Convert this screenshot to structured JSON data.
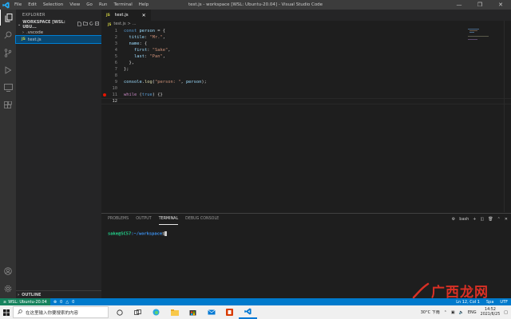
{
  "window": {
    "title": "test.js - workspace [WSL: Ubuntu-20.04] - Visual Studio Code",
    "menu": [
      "File",
      "Edit",
      "Selection",
      "View",
      "Go",
      "Run",
      "Terminal",
      "Help"
    ]
  },
  "sidebar": {
    "header": "EXPLORER",
    "workspace_label": "WORKSPACE [WSL: UBU...",
    "items": [
      {
        "label": ".vscode",
        "type": "folder"
      },
      {
        "label": "test.js",
        "type": "js-file",
        "badge": "JS"
      }
    ],
    "outline_label": "OUTLINE"
  },
  "editor": {
    "tab_label": "test.js",
    "tab_badge": "JS",
    "breadcrumb": [
      "test.js",
      ">",
      "..."
    ],
    "lines": [
      {
        "n": "1",
        "tokens": [
          [
            "kw",
            "const "
          ],
          [
            "var",
            "person"
          ],
          [
            "pl",
            " = {"
          ]
        ]
      },
      {
        "n": "2",
        "tokens": [
          [
            "pl",
            "  "
          ],
          [
            "prop",
            "titile"
          ],
          [
            "pl",
            ": "
          ],
          [
            "str",
            "\"Mr.\""
          ],
          [
            "pl",
            ","
          ]
        ]
      },
      {
        "n": "3",
        "tokens": [
          [
            "pl",
            "  "
          ],
          [
            "prop",
            "name"
          ],
          [
            "pl",
            ": {"
          ]
        ]
      },
      {
        "n": "4",
        "tokens": [
          [
            "pl",
            "    "
          ],
          [
            "prop",
            "first"
          ],
          [
            "pl",
            ": "
          ],
          [
            "str",
            "\"Sake\""
          ],
          [
            "pl",
            ","
          ]
        ]
      },
      {
        "n": "5",
        "tokens": [
          [
            "pl",
            "    "
          ],
          [
            "prop",
            "last"
          ],
          [
            "pl",
            ": "
          ],
          [
            "str",
            "\"Pan\""
          ],
          [
            "pl",
            ","
          ]
        ]
      },
      {
        "n": "6",
        "tokens": [
          [
            "pl",
            "  },"
          ]
        ]
      },
      {
        "n": "7",
        "tokens": [
          [
            "pl",
            "};"
          ]
        ]
      },
      {
        "n": "8",
        "tokens": []
      },
      {
        "n": "9",
        "tokens": [
          [
            "var",
            "console"
          ],
          [
            "pl",
            "."
          ],
          [
            "fn",
            "log"
          ],
          [
            "pl",
            "("
          ],
          [
            "str",
            "\"person: \""
          ],
          [
            "pl",
            ", "
          ],
          [
            "var",
            "person"
          ],
          [
            "pl",
            ");"
          ]
        ]
      },
      {
        "n": "10",
        "tokens": []
      },
      {
        "n": "11",
        "tokens": [
          [
            "ctl",
            "while "
          ],
          [
            "pl",
            "("
          ],
          [
            "kw",
            "true"
          ],
          [
            "pl",
            ") {}"
          ]
        ],
        "breakpoint": true
      },
      {
        "n": "12",
        "tokens": [],
        "current": true
      }
    ]
  },
  "panel": {
    "tabs": [
      "PROBLEMS",
      "OUTPUT",
      "TERMINAL",
      "DEBUG CONSOLE"
    ],
    "active_tab": "TERMINAL",
    "shell": "bash",
    "prompt_user": "sake@SC57",
    "prompt_path": ":~/workspace",
    "prompt_symbol": "$"
  },
  "statusbar": {
    "remote": "WSL: Ubuntu-20.04",
    "errors": "0",
    "warnings": "0",
    "position": "Ln 12, Col 1",
    "spaces": "Spa",
    "encoding": "UTF"
  },
  "taskbar": {
    "search_placeholder": "在这里输入你要搜索的内容",
    "weather": "30°C 下雨",
    "lang": "ENG",
    "time": "14:52",
    "date": "2021/6/25"
  },
  "watermark": {
    "text": "广西龙网"
  },
  "colors": {
    "kw": "#569cd6",
    "ctl": "#c586c0",
    "var": "#9cdcfe",
    "prop": "#9cdcfe",
    "str": "#ce9178",
    "fn": "#dcdcaa",
    "pl": "#d4d4d4",
    "status_bg": "#007acc",
    "remote_bg": "#16825d"
  }
}
